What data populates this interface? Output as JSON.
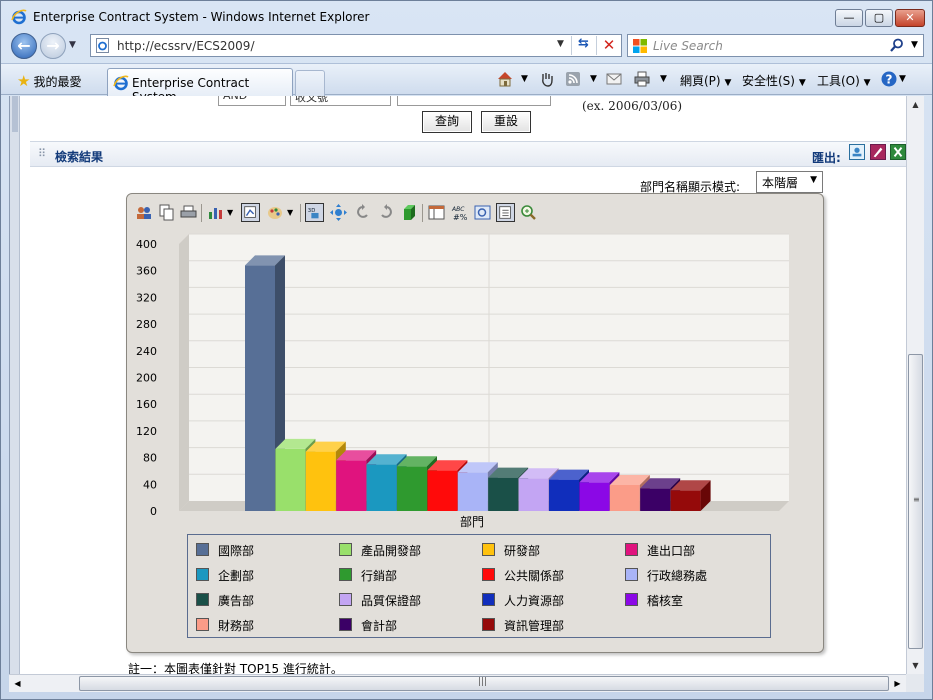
{
  "window": {
    "title": "Enterprise Contract System - Windows Internet Explorer",
    "min_label": "—",
    "max_label": "▢",
    "close_label": "✕"
  },
  "address": {
    "url": "http://ecssrv/ECS2009/",
    "search_placeholder": "Live Search"
  },
  "tabs": {
    "favorites_label": "我的最愛",
    "active_tab_label": "Enterprise Contract System"
  },
  "commandbar": {
    "page_label": "網頁(P)",
    "safety_label": "安全性(S)",
    "tools_label": "工具(O)"
  },
  "form": {
    "operator_value": "AND",
    "field_value": "收文號",
    "date_hint": "(ex. 2006/03/06)",
    "query_label": "查詢",
    "reset_label": "重設"
  },
  "results": {
    "section_title": "檢索結果",
    "export_label": "匯出:",
    "dept_mode_label": "部門名稱顯示模式:",
    "dept_mode_value": "本階層",
    "footnote": "註一：本圖表僅針對 TOP15 進行統計。"
  },
  "chart_data": {
    "type": "bar",
    "xlabel": "部門",
    "ylabel": "",
    "ylim": [
      0,
      400
    ],
    "yticks": [
      0,
      40,
      80,
      120,
      160,
      200,
      240,
      280,
      320,
      360,
      400
    ],
    "grid": true,
    "legend_position": "bottom",
    "categories": [
      "國際部",
      "產品開發部",
      "研發部",
      "進出口部",
      "企劃部",
      "行銷部",
      "公共關係部",
      "行政總務處",
      "廣告部",
      "品質保證部",
      "人力資源部",
      "稽核室",
      "財務部",
      "會計部",
      "資訊管理部"
    ],
    "values": [
      368,
      93,
      89,
      76,
      70,
      67,
      61,
      58,
      50,
      49,
      47,
      43,
      39,
      34,
      31
    ],
    "colors": [
      "#576f96",
      "#99e06b",
      "#ffc20e",
      "#e0137e",
      "#1b98c0",
      "#2f9a2f",
      "#ff0a0a",
      "#a9b4f7",
      "#1a5048",
      "#c3a5f3",
      "#102ebc",
      "#8b08e6",
      "#fb9c88",
      "#3b0066",
      "#950a0a"
    ]
  }
}
